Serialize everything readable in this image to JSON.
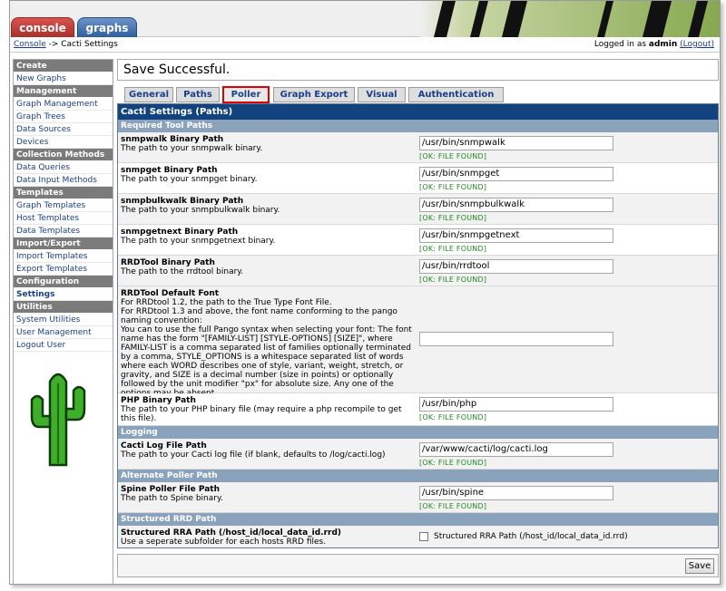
{
  "header": {
    "tabs": [
      {
        "label": "console"
      },
      {
        "label": "graphs"
      }
    ]
  },
  "breadcrumb": {
    "link": "Console",
    "separator": " -> ",
    "current": "Cacti Settings",
    "logged_prefix": "Logged in as ",
    "user": "admin",
    "logout": "(Logout)"
  },
  "sidebar": {
    "groups": [
      {
        "head": "Create",
        "items": [
          "New Graphs"
        ]
      },
      {
        "head": "Management",
        "items": [
          "Graph Management",
          "Graph Trees",
          "Data Sources",
          "Devices"
        ]
      },
      {
        "head": "Collection Methods",
        "items": [
          "Data Queries",
          "Data Input Methods"
        ]
      },
      {
        "head": "Templates",
        "items": [
          "Graph Templates",
          "Host Templates",
          "Data Templates"
        ]
      },
      {
        "head": "Import/Export",
        "items": [
          "Import Templates",
          "Export Templates"
        ]
      },
      {
        "head": "Configuration",
        "items": [
          "Settings"
        ]
      },
      {
        "head": "Utilities",
        "items": [
          "System Utilities",
          "User Management",
          "Logout User"
        ]
      }
    ],
    "active": "Settings"
  },
  "message": "Save Successful.",
  "tabs": [
    "General",
    "Paths",
    "Poller",
    "Graph Export",
    "Visual",
    "Authentication"
  ],
  "selected_tab": "Poller",
  "panel_title": "Cacti Settings (Paths)",
  "ok_text": "[OK: FILE FOUND]",
  "sections": {
    "required": "Required Tool Paths",
    "logging": "Logging",
    "alternate": "Alternate Poller Path",
    "structured": "Structured RRD Path"
  },
  "fields": {
    "snmpwalk": {
      "title": "snmpwalk Binary Path",
      "desc": "The path to your snmpwalk binary.",
      "value": "/usr/bin/snmpwalk"
    },
    "snmpget": {
      "title": "snmpget Binary Path",
      "desc": "The path to your snmpget binary.",
      "value": "/usr/bin/snmpget"
    },
    "snmpbulkwalk": {
      "title": "snmpbulkwalk Binary Path",
      "desc": "The path to your snmpbulkwalk binary.",
      "value": "/usr/bin/snmpbulkwalk"
    },
    "snmpgetnext": {
      "title": "snmpgetnext Binary Path",
      "desc": "The path to your snmpgetnext binary.",
      "value": "/usr/bin/snmpgetnext"
    },
    "rrdtool": {
      "title": "RRDTool Binary Path",
      "desc": "The path to the rrdtool binary.",
      "value": "/usr/bin/rrdtool"
    },
    "font": {
      "title": "RRDTool Default Font",
      "desc": "For RRDtool 1.2, the path to the True Type Font File.\nFor RRDtool 1.3 and above, the font name conforming to the pango naming convention:\nYou can to use the full Pango syntax when selecting your font: The font name has the form \"[FAMILY-LIST] [STYLE-OPTIONS] [SIZE]\", where FAMILY-LIST is a comma separated list of families optionally terminated by a comma, STYLE_OPTIONS is a whitespace separated list of words where each WORD describes one of style, variant, weight, stretch, or gravity, and SIZE is a decimal number (size in points) or optionally followed by the unit modifier \"px\" for absolute size. Any one of the options may be absent.",
      "value": ""
    },
    "php": {
      "title": "PHP Binary Path",
      "desc": "The path to your PHP binary file (may require a php recompile to get this file).",
      "value": "/usr/bin/php"
    },
    "log": {
      "title": "Cacti Log File Path",
      "desc": "The path to your Cacti log file (if blank, defaults to /log/cacti.log)",
      "value": "/var/www/cacti/log/cacti.log"
    },
    "spine": {
      "title": "Spine Poller File Path",
      "desc": "The path to Spine binary.",
      "value": "/usr/bin/spine"
    },
    "structured": {
      "title": "Structured RRA Path (/host_id/local_data_id.rrd)",
      "desc": "Use a seperate subfolder for each hosts RRD files.",
      "checkbox_label": "Structured RRA Path (/host_id/local_data_id.rrd)"
    }
  },
  "save_label": "Save",
  "colors": {
    "panel_title": "#12437f",
    "section": "#8ba2bd",
    "ok": "#1e8a1e",
    "selected_tab_border": "#e00000"
  }
}
